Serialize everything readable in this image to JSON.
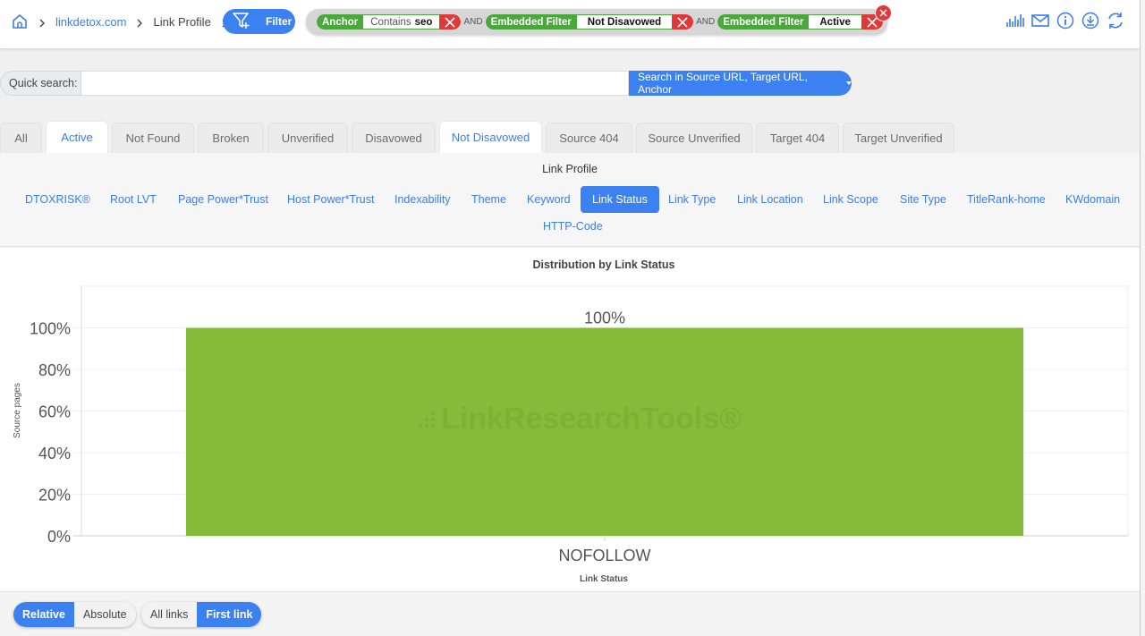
{
  "breadcrumb": {
    "items": [
      {
        "label": "linkdetox.com",
        "link": true
      },
      {
        "label": "Link Profile",
        "link": false
      }
    ]
  },
  "filter_button": {
    "label": "Filter"
  },
  "filters": [
    {
      "key": "Anchor",
      "operator": "Contains",
      "value": "seo"
    },
    {
      "key": "Embedded Filter",
      "operator": "",
      "value": "Not Disavowed"
    },
    {
      "key": "Embedded Filter",
      "operator": "",
      "value": "Active"
    }
  ],
  "filter_joiner": "AND",
  "toolbar": {
    "icons": [
      "chart-bars-icon",
      "mail-icon",
      "info-icon",
      "download-icon",
      "refresh-icon"
    ]
  },
  "quick_search": {
    "label": "Quick search:",
    "value": "",
    "placeholder": "",
    "scope_button": "Search in Source URL, Target URL, Anchor"
  },
  "status_tabs": [
    {
      "label": "All",
      "active": false
    },
    {
      "label": "Active",
      "active": true
    },
    {
      "label": "Not Found",
      "active": false
    },
    {
      "label": "Broken",
      "active": false
    },
    {
      "label": "Unverified",
      "active": false
    },
    {
      "label": "Disavowed",
      "active": false
    },
    {
      "label": "Not Disavowed",
      "active": true
    },
    {
      "label": "Source 404",
      "active": false
    },
    {
      "label": "Source Unverified",
      "active": false
    },
    {
      "label": "Target 404",
      "active": false
    },
    {
      "label": "Target Unverified",
      "active": false
    }
  ],
  "link_profile": {
    "title": "Link Profile",
    "items": [
      {
        "label": "DTOXRISK®",
        "active": false
      },
      {
        "label": "Root LVT",
        "active": false
      },
      {
        "label": "Page Power*Trust",
        "active": false
      },
      {
        "label": "Host Power*Trust",
        "active": false
      },
      {
        "label": "Indexability",
        "active": false
      },
      {
        "label": "Theme",
        "active": false
      },
      {
        "label": "Keyword",
        "active": false
      },
      {
        "label": "Link Status",
        "active": true
      },
      {
        "label": "Link Type",
        "active": false
      },
      {
        "label": "Link Location",
        "active": false
      },
      {
        "label": "Link Scope",
        "active": false
      },
      {
        "label": "Site Type",
        "active": false
      },
      {
        "label": "TitleRank-home",
        "active": false
      },
      {
        "label": "KWdomain",
        "active": false
      },
      {
        "label": "HTTP-Code",
        "active": false
      }
    ]
  },
  "chart_data": {
    "type": "bar",
    "title": "Distribution by Link Status",
    "xlabel": "Link Status",
    "ylabel": "Source pages",
    "categories": [
      "NOFOLLOW"
    ],
    "values": [
      100
    ],
    "value_labels": [
      "100%"
    ],
    "ylim": [
      0,
      120
    ],
    "yticks": [
      0,
      20,
      40,
      60,
      80,
      100
    ],
    "ytick_labels": [
      "0%",
      "20%",
      "40%",
      "60%",
      "80%",
      "100%"
    ],
    "grid": true,
    "legend": "none",
    "bar_color": "#86bb39",
    "watermark": "LinkResearchTools®"
  },
  "bottom_toggles": {
    "mode": [
      {
        "label": "Relative",
        "on": true
      },
      {
        "label": "Absolute",
        "on": false
      }
    ],
    "scope": [
      {
        "label": "All links",
        "on": false
      },
      {
        "label": "First link",
        "on": true
      }
    ]
  },
  "colors": {
    "accent": "#3b82f0",
    "chip_green": "#4aa83b",
    "chip_red": "#e0393a",
    "bar": "#86bb39"
  }
}
